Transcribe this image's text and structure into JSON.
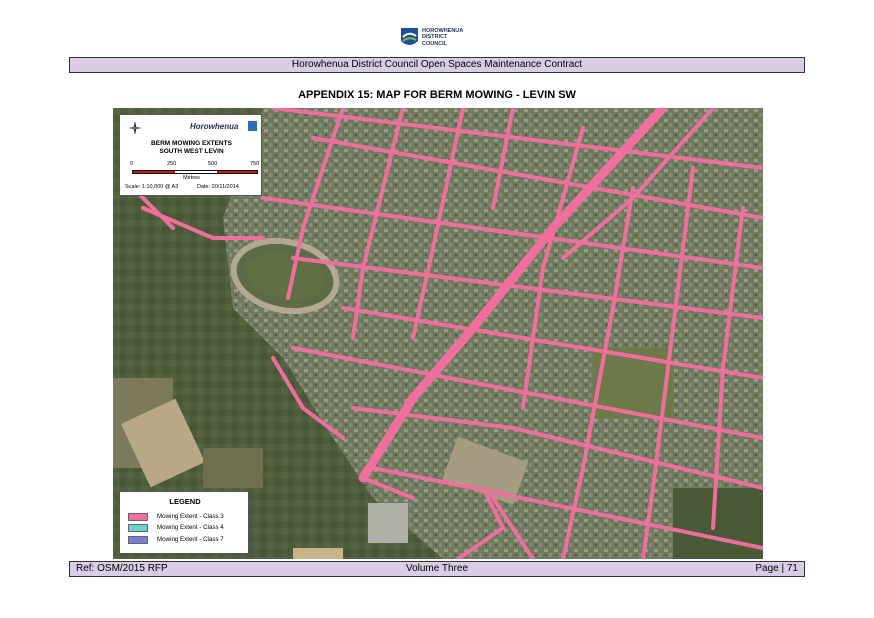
{
  "logo": {
    "lines": [
      "HOROWHENUA",
      "DISTRICT",
      "COUNCIL"
    ]
  },
  "header": {
    "text": "Horowhenua District Council Open Spaces Maintenance Contract"
  },
  "title": "APPENDIX 15:  MAP FOR BERM MOWING - LEVIN SW",
  "map_info": {
    "brand": "Horowhenua",
    "title_lines": [
      "BERM MOWING EXTENTS",
      "SOUTH WEST LEVIN"
    ],
    "scale_ticks": [
      "0",
      "250",
      "500",
      "750"
    ],
    "scale_unit": "Metres",
    "scale": "Scale: 1:10,000 @ A3",
    "date": "Date: 20/11/2014"
  },
  "legend": {
    "title": "LEGEND",
    "items": [
      {
        "label": "Mowing Extent - Class 3",
        "color": "#f06e9b"
      },
      {
        "label": "Mowing Extent - Class 4",
        "color": "#67d4cc"
      },
      {
        "label": "Mowing Extent - Class 7",
        "color": "#7a7fd6"
      }
    ]
  },
  "colors": {
    "berm": "#f06e9b",
    "header_bg": "#d9cde6",
    "brand": "#1e2f5c"
  },
  "footer": {
    "left": "Ref: OSM/2015 RFP",
    "center": "Volume Three",
    "right": "Page | 71"
  }
}
